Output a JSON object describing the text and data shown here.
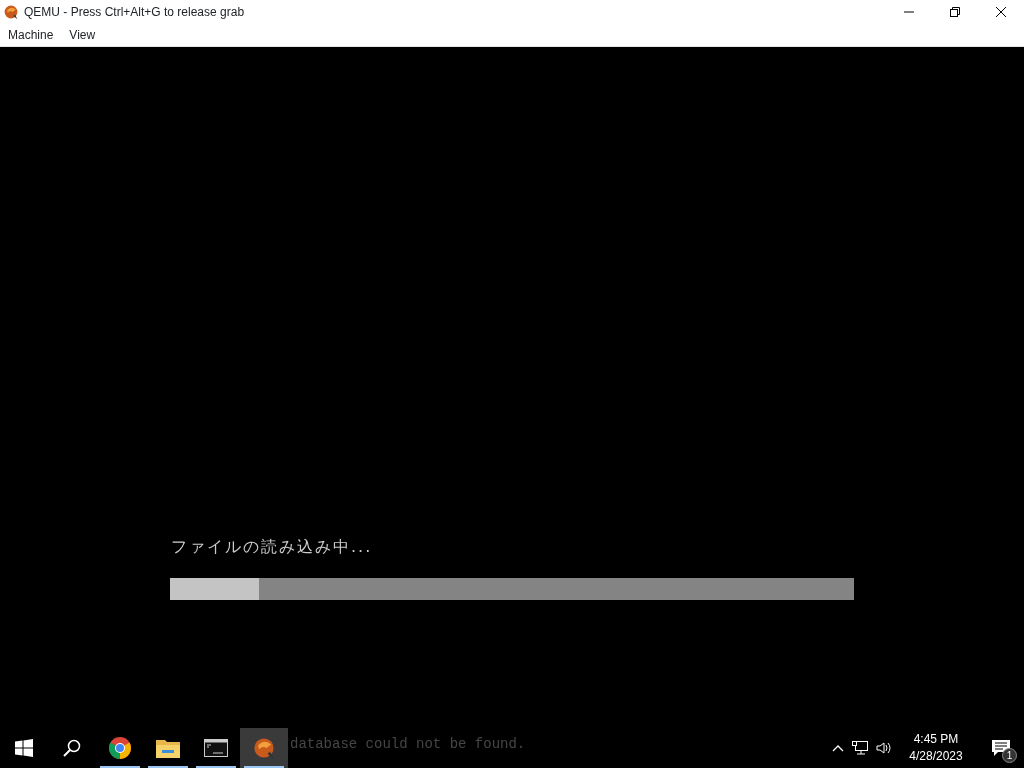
{
  "window": {
    "title": "QEMU - Press Ctrl+Alt+G to release grab"
  },
  "menu": [
    "Machine",
    "View"
  ],
  "guest_screen": {
    "message": "ファイルの読み込み中...",
    "progress": {
      "level": 0.13
    },
    "console_text": "database could not be found."
  },
  "taskbar": {
    "apps": [
      {
        "kind": "start",
        "running": false,
        "selected": false
      },
      {
        "kind": "search",
        "running": false,
        "selected": false
      },
      {
        "kind": "chrome",
        "running": true,
        "selected": false
      },
      {
        "kind": "folder",
        "running": true,
        "selected": false
      },
      {
        "kind": "terminal",
        "running": true,
        "selected": false
      },
      {
        "kind": "qemu",
        "running": true,
        "selected": true
      }
    ],
    "tray": {
      "time": "4:45 PM",
      "date": "4/28/2023",
      "notifications": "1"
    }
  }
}
